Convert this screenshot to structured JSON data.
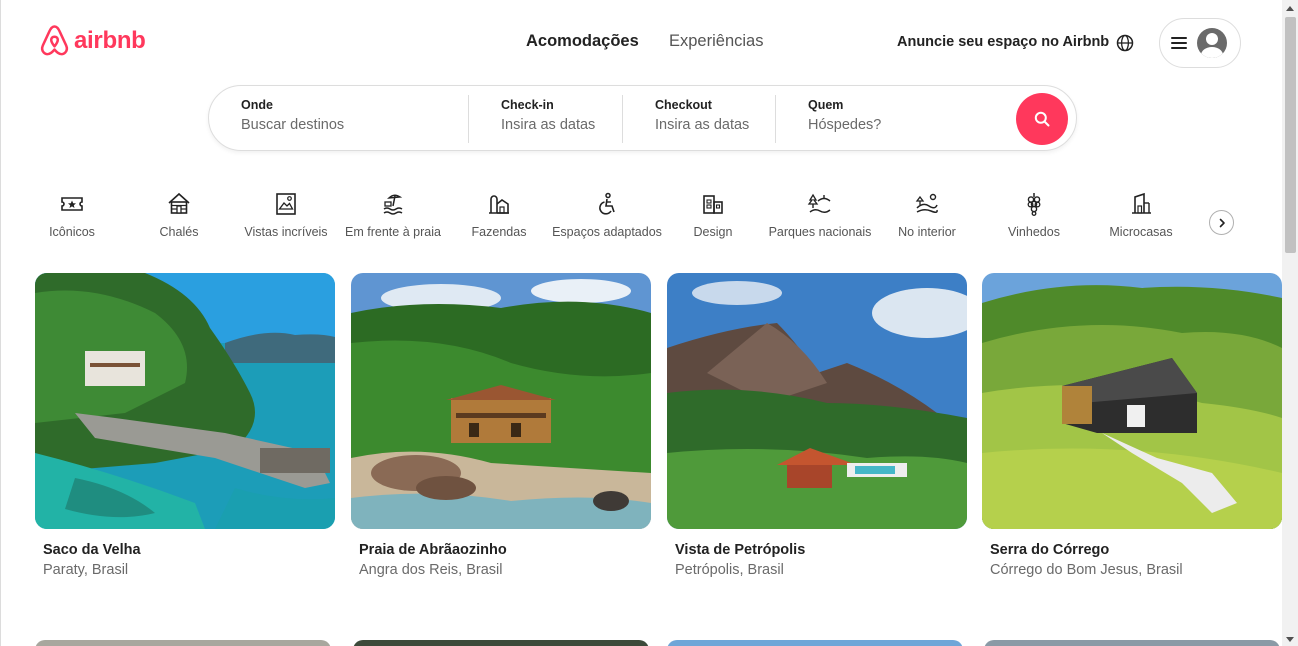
{
  "brand": {
    "name": "airbnb",
    "color": "#ff385c",
    "icon": "airbnb-belo-icon"
  },
  "header": {
    "tabs": [
      {
        "label": "Acomodações",
        "active": true
      },
      {
        "label": "Experiências",
        "active": false
      }
    ],
    "host_link": "Anuncie seu espaço no Airbnb",
    "globe_icon": "globe-icon",
    "menu_icon": "hamburger-menu-icon",
    "avatar_icon": "user-avatar-icon"
  },
  "search": {
    "where": {
      "label": "Onde",
      "placeholder": "Buscar destinos"
    },
    "checkin": {
      "label": "Check-in",
      "placeholder": "Insira as datas"
    },
    "checkout": {
      "label": "Checkout",
      "placeholder": "Insira as datas"
    },
    "who": {
      "label": "Quem",
      "placeholder": "Hóspedes?"
    },
    "button_icon": "search-icon"
  },
  "categories": [
    {
      "label": "Icônicos",
      "icon": "ticket-star-icon"
    },
    {
      "label": "Chalés",
      "icon": "cabin-icon"
    },
    {
      "label": "Vistas incríveis",
      "icon": "framed-view-icon"
    },
    {
      "label": "Em frente à praia",
      "icon": "beachfront-icon"
    },
    {
      "label": "Fazendas",
      "icon": "farm-icon"
    },
    {
      "label": "Espaços adaptados",
      "icon": "accessible-icon"
    },
    {
      "label": "Design",
      "icon": "design-building-icon"
    },
    {
      "label": "Parques nacionais",
      "icon": "national-park-icon"
    },
    {
      "label": "No interior",
      "icon": "countryside-icon"
    },
    {
      "label": "Vinhedos",
      "icon": "grapes-icon"
    },
    {
      "label": "Microcasas",
      "icon": "tiny-house-icon"
    }
  ],
  "categories_next_icon": "chevron-right-icon",
  "listings": [
    {
      "title": "Saco da Velha",
      "location": "Paraty, Brasil"
    },
    {
      "title": "Praia de Abrãaozinho",
      "location": "Angra dos Reis, Brasil"
    },
    {
      "title": "Vista de Petrópolis",
      "location": "Petrópolis, Brasil"
    },
    {
      "title": "Serra do Córrego",
      "location": "Córrego do Bom Jesus, Brasil"
    }
  ]
}
